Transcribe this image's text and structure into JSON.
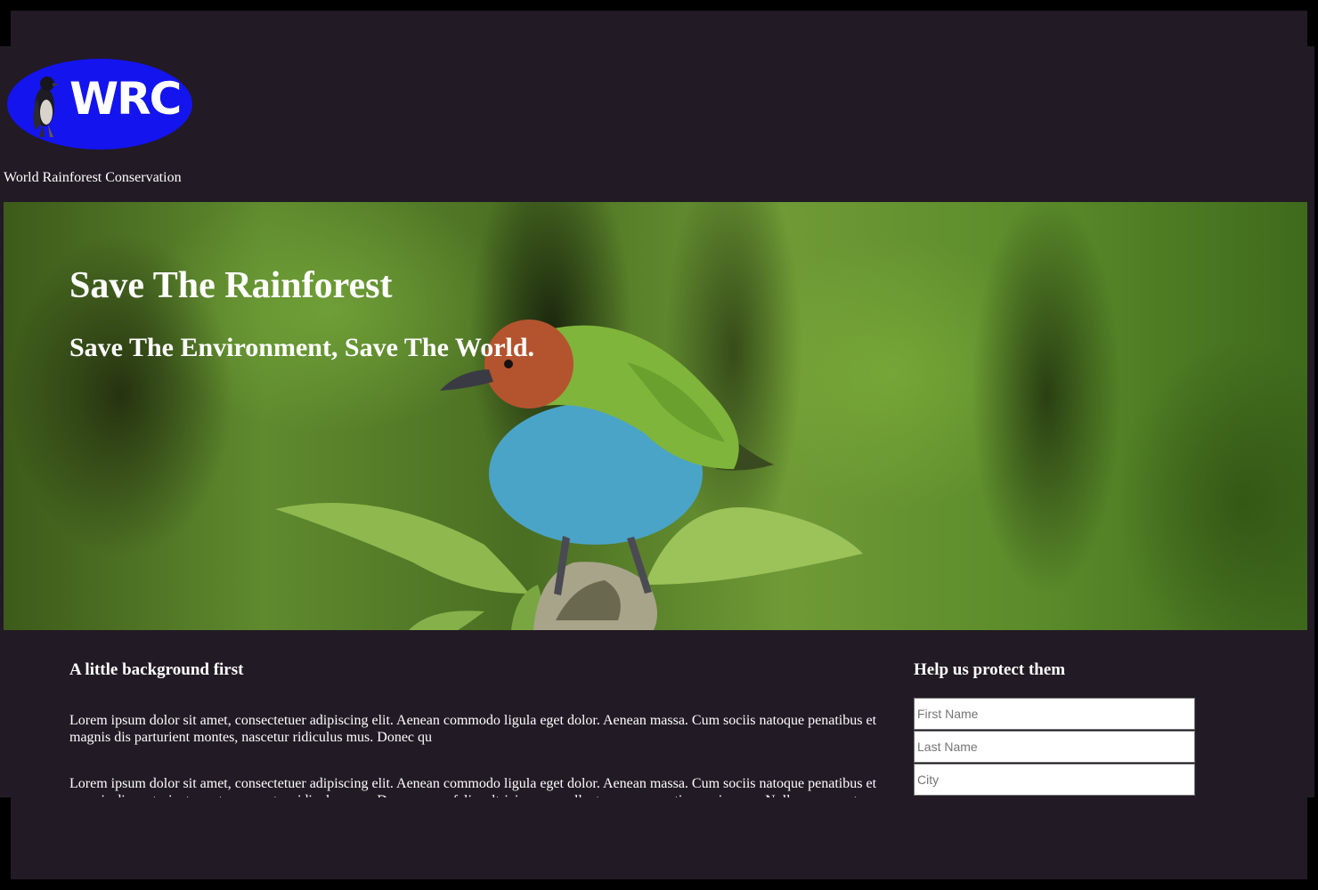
{
  "logo": {
    "text": "WRC",
    "icon": "bird-icon"
  },
  "org_name": "World Rainforest Conservation",
  "hero": {
    "title": "Save The Rainforest",
    "subtitle": "Save The Environment, Save The World."
  },
  "content": {
    "heading": "A little background first",
    "paragraphs": [
      "Lorem ipsum dolor sit amet, consectetuer adipiscing elit. Aenean commodo ligula eget dolor. Aenean massa. Cum sociis natoque penatibus et magnis dis parturient montes, nascetur ridiculus mus. Donec qu",
      "Lorem ipsum dolor sit amet, consectetuer adipiscing elit. Aenean commodo ligula eget dolor. Aenean massa. Cum sociis natoque penatibus et magnis dis parturient montes, nascetur ridiculus mus. Donec quam felis, ultricies nec, pellentesque eu, pretium quis, sem. Nulla consequat"
    ]
  },
  "signup": {
    "heading": "Help us protect them",
    "first_name_placeholder": "First Name",
    "last_name_placeholder": "Last Name",
    "city_placeholder": "City"
  },
  "colors": {
    "page_background": "#221a24",
    "logo_blue": "#1414ee",
    "text": "#ffffff"
  }
}
